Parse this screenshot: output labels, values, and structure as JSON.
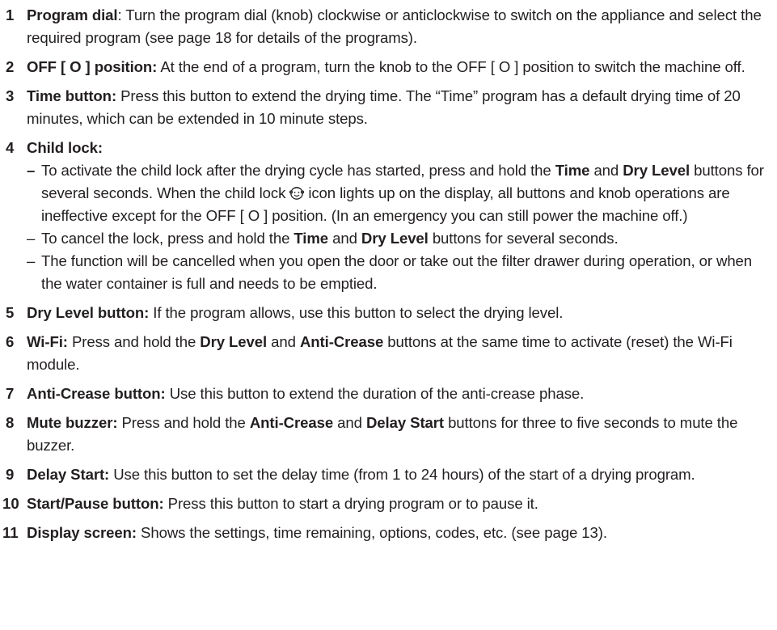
{
  "items": [
    {
      "num": "1",
      "title": "Program dial",
      "sep": ": ",
      "text": "Turn the program dial (knob) clockwise or anticlockwise to switch on the appliance and select the required program (see page 18 for details of the programs)."
    },
    {
      "num": "2",
      "title": "OFF [ O ] position:",
      "text": " At the end of a program, turn the knob to the OFF [ O ] position to switch the machine off."
    },
    {
      "num": "3",
      "title": "Time button:",
      "text": " Press this button to extend the drying time. The “Time” program has a default drying time of 20 minutes, which can be extended in 10 minute steps."
    },
    {
      "num": "4",
      "title": "Child lock:",
      "sub": [
        {
          "dash": "–",
          "t1": " To activate the child lock after the drying cycle has started, press and hold the ",
          "b1": "Time",
          "t2": " and ",
          "b2": "Dry Level",
          "t3": " buttons for several seconds. When the child lock",
          "icon": "child-lock-icon",
          "t4": "icon lights up on the display, all buttons and knob operations are ineffective except for the OFF [ O ] position. (In an emergency you can still power the machine off.)"
        },
        {
          "dash": "–",
          "t1": " To cancel the lock, press and hold the ",
          "b1": "Time",
          "t2": " and ",
          "b2": "Dry Level",
          "t3": " buttons for several seconds."
        },
        {
          "dash": "–",
          "t1": " The function will be cancelled when you open the door or take out the filter drawer during operation, or when the water container is full and needs to be emptied."
        }
      ]
    },
    {
      "num": "5",
      "title": "Dry Level button:",
      "text": " If the program allows, use this button to select the drying level."
    },
    {
      "num": "6",
      "title": "Wi-Fi:",
      "t1": " Press and hold the ",
      "b1": "Dry Level",
      "t2": " and ",
      "b2": "Anti-Crease",
      "t3": " buttons at the same time to activate (reset) the Wi-Fi module."
    },
    {
      "num": "7",
      "title": "Anti-Crease button:",
      "text": " Use this button to extend the duration of the anti-crease phase."
    },
    {
      "num": "8",
      "title": "Mute buzzer:",
      "t1": " Press and hold the ",
      "b1": "Anti-Crease",
      "t2": " and ",
      "b2": "Delay Start",
      "t3": " buttons for three to five seconds to mute the buzzer."
    },
    {
      "num": "9",
      "title": "Delay Start:",
      "text": " Use this button to set the delay time (from 1 to 24 hours) of the start of a drying program."
    },
    {
      "num": "10",
      "title": "Start/Pause button:",
      "text": " Press this button to start a drying program or to pause it."
    },
    {
      "num": "11",
      "title": "Display screen:",
      "text": " Shows the settings, time remaining, options, codes, etc. (see page 13)."
    }
  ]
}
